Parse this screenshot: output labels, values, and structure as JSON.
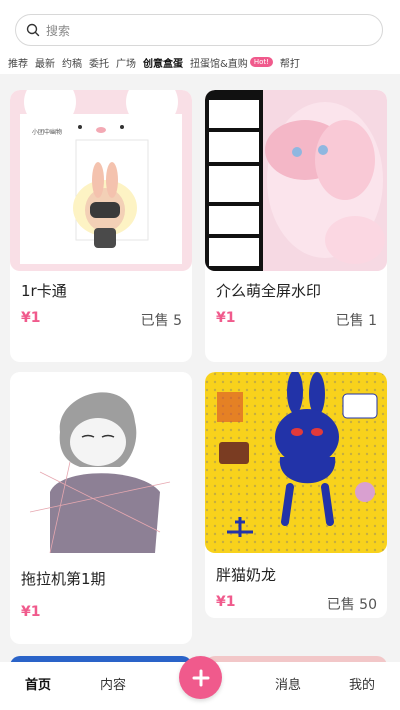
{
  "search": {
    "placeholder": "搜索",
    "icon": "search-icon"
  },
  "tabs": [
    {
      "label": "推荐",
      "active": false
    },
    {
      "label": "最新",
      "active": false
    },
    {
      "label": "约稿",
      "active": false
    },
    {
      "label": "委托",
      "active": false
    },
    {
      "label": "广场",
      "active": false
    },
    {
      "label": "创意盒蛋",
      "active": true
    },
    {
      "label": "扭蛋馆&直购",
      "active": false,
      "badge": "Hot!"
    },
    {
      "label": "帮打",
      "active": false
    }
  ],
  "cards": [
    {
      "title": "1r卡通",
      "price": "¥1",
      "sold": "已售 5"
    },
    {
      "title": "介么萌全屏水印",
      "price": "¥1",
      "sold": "已售 1"
    },
    {
      "title": "拖拉机第1期",
      "price": "¥1",
      "sold": ""
    },
    {
      "title": "胖猫奶龙",
      "price": "¥1",
      "sold": "已售 50"
    }
  ],
  "bottom_nav": {
    "home": "首页",
    "content": "内容",
    "add_icon": "plus-icon",
    "messages": "消息",
    "mine": "我的"
  },
  "colors": {
    "accent": "#f05a8c",
    "background": "#f3f3f3"
  }
}
